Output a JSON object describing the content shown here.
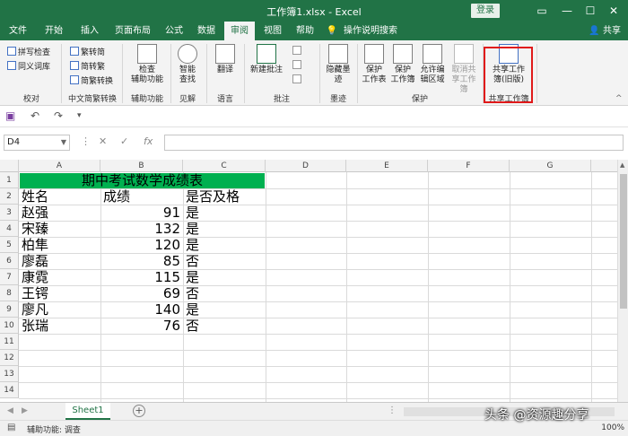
{
  "window": {
    "title": "工作簿1.xlsx  -  Excel",
    "login": "登录",
    "share": "共享"
  },
  "tabs": [
    "文件",
    "开始",
    "插入",
    "页面布局",
    "公式",
    "数据",
    "审阅",
    "视图",
    "帮助",
    "操作说明搜索"
  ],
  "active_tab": "审阅",
  "ribbon": {
    "proofing": {
      "items": [
        "拼写检查",
        "同义词库"
      ],
      "label": "校对"
    },
    "chinese": {
      "items": [
        "繁转简",
        "简转繁",
        "简繁转换"
      ],
      "label": "中文简繁转换"
    },
    "accessibility": {
      "button": "检查\n辅助功能",
      "label": "辅助功能"
    },
    "insights": {
      "button": "智能\n查找",
      "label": "见解"
    },
    "language": {
      "button": "翻译",
      "label": "语言"
    },
    "comments": {
      "button": "新建批注",
      "label": "批注"
    },
    "ink": {
      "button": "隐藏墨\n迹",
      "label": "墨迹"
    },
    "protect": {
      "buttons": [
        "保护\n工作表",
        "保护\n工作簿",
        "允许编\n辑区域",
        "取消共\n享工作簿"
      ],
      "label": "保护"
    },
    "share_workbook": {
      "button": "共享工作\n簿(旧版)",
      "label": "共享工作簿"
    }
  },
  "formula_bar": {
    "name_box": "D4",
    "fx": "fx",
    "value": ""
  },
  "columns": [
    "A",
    "B",
    "C",
    "D",
    "E",
    "F",
    "G"
  ],
  "rows": [
    "1",
    "2",
    "3",
    "4",
    "5",
    "6",
    "7",
    "8",
    "9",
    "10",
    "11",
    "12",
    "13",
    "14"
  ],
  "sheet": {
    "title": "期中考试数学成绩表",
    "headers": [
      "姓名",
      "成绩",
      "是否及格"
    ],
    "data": [
      [
        "赵强",
        "91",
        "是"
      ],
      [
        "宋臻",
        "132",
        "是"
      ],
      [
        "柏隼",
        "120",
        "是"
      ],
      [
        "廖磊",
        "85",
        "否"
      ],
      [
        "康霓",
        "115",
        "是"
      ],
      [
        "王锷",
        "69",
        "否"
      ],
      [
        "廖凡",
        "140",
        "是"
      ],
      [
        "张瑞",
        "76",
        "否"
      ]
    ]
  },
  "sheet_tab": "Sheet1",
  "status": {
    "accessibility": "辅助功能: 调查",
    "zoom": "100%"
  },
  "watermark": "头条 @资源趣分享"
}
